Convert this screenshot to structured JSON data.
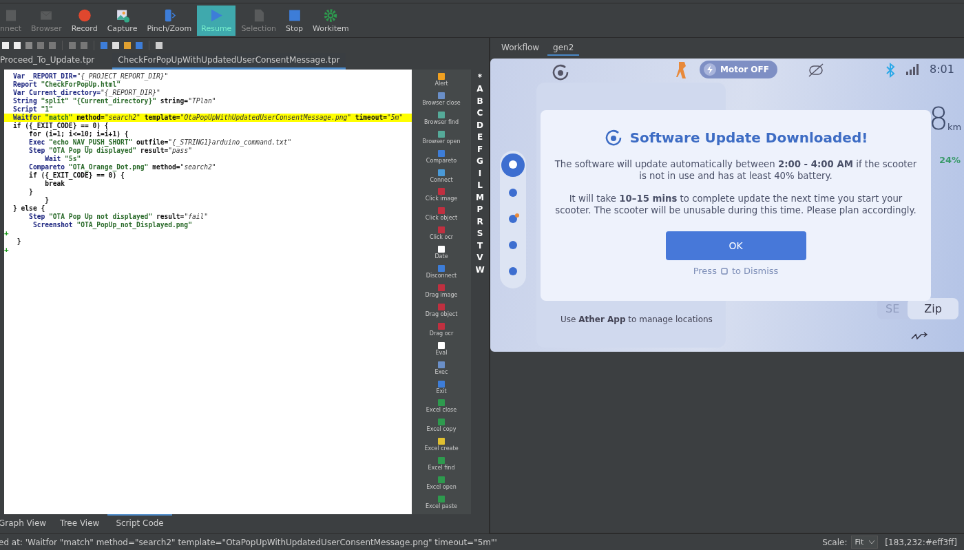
{
  "toolbar": [
    {
      "label": "nnect",
      "disabled": true,
      "active": false
    },
    {
      "label": "Browser",
      "disabled": true,
      "active": false
    },
    {
      "label": "Record",
      "disabled": false,
      "active": false
    },
    {
      "label": "Capture",
      "disabled": false,
      "active": false
    },
    {
      "label": "Pinch/Zoom",
      "disabled": false,
      "active": false
    },
    {
      "label": "Resume",
      "disabled": true,
      "active": true
    },
    {
      "label": "Selection",
      "disabled": true,
      "active": false
    },
    {
      "label": "Stop",
      "disabled": false,
      "active": false
    },
    {
      "label": "Workitem",
      "disabled": false,
      "active": false
    }
  ],
  "file_tabs": [
    {
      "label": "Proceed_To_Update.tpr",
      "selected": false
    },
    {
      "label": "CheckForPopUpWithUpdatedUserConsentMessage.tpr",
      "selected": true
    }
  ],
  "code_lines": [
    {
      "highlighted": false,
      "segs": [
        {
          "kind": "keyword",
          "t": "Var"
        },
        {
          "kind": "name",
          "t": " _REPORT_DIR="
        },
        {
          "kind": "value",
          "t": "\"{_PROJECT_REPORT_DIR}\""
        }
      ]
    },
    {
      "highlighted": false,
      "segs": [
        {
          "kind": "keyword",
          "t": "Report"
        },
        {
          "kind": "string",
          "t": " \"CheckForPopUp.html\""
        }
      ]
    },
    {
      "highlighted": false,
      "segs": [
        {
          "kind": "keyword",
          "t": "Var"
        },
        {
          "kind": "name",
          "t": " Current_directory="
        },
        {
          "kind": "value",
          "t": "\"{_REPORT_DIR}\""
        }
      ]
    },
    {
      "highlighted": false,
      "segs": [
        {
          "kind": "keyword",
          "t": "String"
        },
        {
          "kind": "string",
          "t": " \"split\" \"{Current_directory}\""
        },
        {
          "kind": "param",
          "t": " string="
        },
        {
          "kind": "value",
          "t": "\"TPlan\""
        }
      ]
    },
    {
      "highlighted": false,
      "segs": [
        {
          "kind": "keyword",
          "t": "Script"
        },
        {
          "kind": "string",
          "t": " \"1\""
        }
      ]
    },
    {
      "highlighted": true,
      "segs": [
        {
          "kind": "keyword",
          "t": "Waitfor"
        },
        {
          "kind": "string",
          "t": " \"match\""
        },
        {
          "kind": "param",
          "t": " method="
        },
        {
          "kind": "value",
          "t": "\"search2\""
        },
        {
          "kind": "param",
          "t": " template="
        },
        {
          "kind": "value",
          "t": "\"OtaPopUpWithUpdatedUserConsentMessage.png\""
        },
        {
          "kind": "param",
          "t": " timeout="
        },
        {
          "kind": "value",
          "t": "\"5m\""
        }
      ]
    },
    {
      "highlighted": false,
      "segs": [
        {
          "kind": "control",
          "t": "if ({_EXIT_CODE} == 0) {"
        }
      ]
    },
    {
      "highlighted": false,
      "segs": [
        {
          "kind": "control",
          "t": "    for (i=1; i<=10; i=i+1) {"
        }
      ]
    },
    {
      "highlighted": false,
      "segs": [
        {
          "kind": "keyword",
          "t": "    Exec"
        },
        {
          "kind": "string",
          "t": " \"echo NAV_PUSH_SHORT\""
        },
        {
          "kind": "param",
          "t": " outfile="
        },
        {
          "kind": "value",
          "t": "\"{_STRING1}arduino_command.txt\""
        }
      ]
    },
    {
      "highlighted": false,
      "segs": [
        {
          "kind": "keyword",
          "t": "    Step"
        },
        {
          "kind": "string",
          "t": " \"OTA Pop Up displayed\""
        },
        {
          "kind": "param",
          "t": " result="
        },
        {
          "kind": "value",
          "t": "\"pass\""
        }
      ]
    },
    {
      "highlighted": false,
      "segs": [
        {
          "kind": "keyword",
          "t": "        Wait"
        },
        {
          "kind": "string",
          "t": " \"5s\""
        }
      ]
    },
    {
      "highlighted": false,
      "segs": [
        {
          "kind": "keyword",
          "t": "    Compareto"
        },
        {
          "kind": "string",
          "t": " \"OTA_Orange_Dot.png\""
        },
        {
          "kind": "param",
          "t": " method="
        },
        {
          "kind": "value",
          "t": "\"search2\""
        }
      ]
    },
    {
      "highlighted": false,
      "segs": [
        {
          "kind": "control",
          "t": "    if ({_EXIT_CODE} == 0) {"
        }
      ]
    },
    {
      "highlighted": false,
      "segs": [
        {
          "kind": "control",
          "t": "        break"
        }
      ]
    },
    {
      "highlighted": false,
      "segs": [
        {
          "kind": "control",
          "t": "    }"
        }
      ]
    },
    {
      "highlighted": false,
      "segs": [
        {
          "kind": "control",
          "t": "        }"
        }
      ]
    },
    {
      "highlighted": false,
      "segs": [
        {
          "kind": "control",
          "t": "} else {"
        }
      ]
    },
    {
      "highlighted": false,
      "segs": [
        {
          "kind": "keyword",
          "t": "    Step"
        },
        {
          "kind": "string",
          "t": " \"OTA Pop Up not displayed\""
        },
        {
          "kind": "param",
          "t": " result="
        },
        {
          "kind": "value",
          "t": "\"fail\""
        }
      ]
    },
    {
      "highlighted": false,
      "segs": [
        {
          "kind": "keyword",
          "t": "     Screenshot"
        },
        {
          "kind": "string",
          "t": " \"OTA_PopUp_not_Displayed.png\""
        }
      ]
    },
    {
      "highlighted": false,
      "marker": "+"
    },
    {
      "highlighted": false,
      "segs": [
        {
          "kind": "control",
          "t": " }"
        }
      ]
    },
    {
      "highlighted": false,
      "marker": "+"
    }
  ],
  "palette": [
    "Alert",
    "Browser close",
    "Browser find",
    "Browser open",
    "Compareto",
    "Connect",
    "Click image",
    "Click object",
    "Click ocr",
    "Date",
    "Disconnect",
    "Drag image",
    "Drag object",
    "Drag ocr",
    "Eval",
    "Exec",
    "Exit",
    "Excel close",
    "Excel copy",
    "Excel create",
    "Excel find",
    "Excel open",
    "Excel paste"
  ],
  "alphabet": [
    "*",
    "A",
    "B",
    "C",
    "D",
    "E",
    "F",
    "G",
    "I",
    "L",
    "M",
    "P",
    "R",
    "S",
    "T",
    "V",
    "W"
  ],
  "bottom_tabs": [
    {
      "label": "Graph View",
      "selected": false
    },
    {
      "label": "Tree View",
      "selected": false
    },
    {
      "label": "Script Code",
      "selected": true
    }
  ],
  "status_bar": {
    "message": "ed at: 'Waitfor \"match\" method=\"search2\" template=\"OtaPopUpWithUpdatedUserConsentMessage.png\" timeout=\"5m\"'",
    "scale_label": "Scale:",
    "scale_value": "Fit",
    "pixel": "[183,232:#eff3ff]"
  },
  "right_tabs": [
    {
      "label": "Workflow",
      "selected": false
    },
    {
      "label": "gen2",
      "selected": true
    }
  ],
  "device": {
    "motor": "Motor OFF",
    "time": "8:01",
    "distance": "8",
    "unit": "km",
    "battery": "24%",
    "nav": [
      {
        "selected": true
      },
      {
        "selected": false
      },
      {
        "selected": false
      },
      {
        "selected": false
      },
      {
        "selected": false
      }
    ],
    "locations_note": "Use **Ather App** to manage locations",
    "modes": [
      {
        "label": "SE",
        "selected": false
      },
      {
        "label": "Zip",
        "selected": true
      }
    ],
    "popup": {
      "title": "Software Update Downloaded!",
      "paragraphs": [
        "The software will update automatically between **2:00 - 4:00 AM** if the scooter is not in use and has at least 40% battery.",
        "It will take **10–15 mins** to complete update the next time you start your scooter. The scooter will be unusable during this time. Please plan accordingly."
      ],
      "button": "OK",
      "hint_before": "Press",
      "hint_after": "to Dismiss"
    }
  }
}
